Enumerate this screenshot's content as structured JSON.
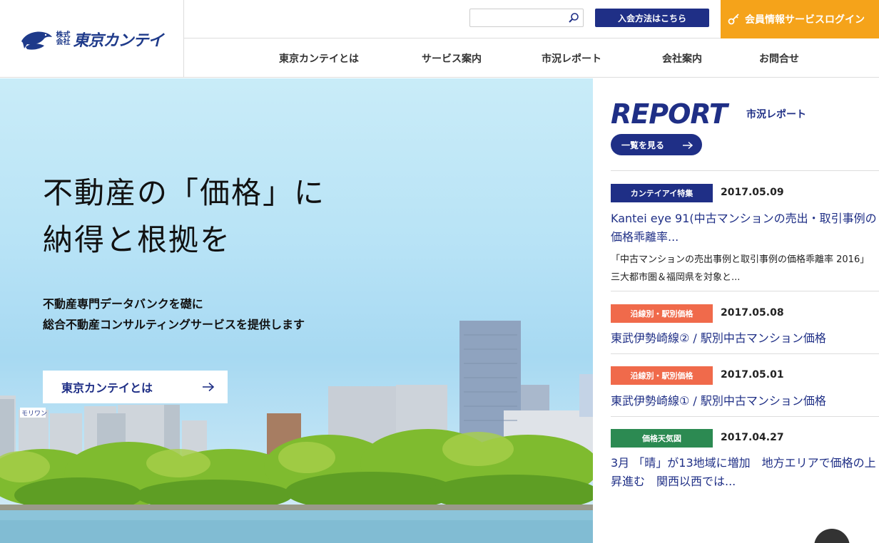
{
  "header": {
    "logo": {
      "kabu_top": "株式",
      "kabu_bottom": "会社",
      "name": "東京カンテイ"
    },
    "search": {
      "placeholder": ""
    },
    "join_label": "入会方法はこちら",
    "login_label": "会員情報サービスログイン",
    "nav": [
      "東京カンテイとは",
      "サービス案内",
      "市況レポート",
      "会社案内",
      "お問合せ"
    ]
  },
  "hero": {
    "title_line1": "不動産の「価格」に",
    "title_line2": "納得と根拠を",
    "sub_line1": "不動産専門データバンクを礎に",
    "sub_line2": "総合不動産コンサルティングサービスを提供します",
    "button_label": "東京カンテイとは",
    "sign_text": "モリワン"
  },
  "report": {
    "title": "REPORT",
    "subtitle": "市況レポート",
    "all_label": "一覧を見る",
    "items": [
      {
        "category": "カンテイアイ特集",
        "color": "#1f2f86",
        "date": "2017.05.09",
        "title": "Kantei eye 91(中古マンションの売出・取引事例の価格乖離率...",
        "desc": "「中古マンションの売出事例と取引事例の価格乖離率 2016」 三大都市圏＆福岡県を対象と..."
      },
      {
        "category": "沿線別・駅別価格",
        "color": "#f06a4b",
        "date": "2017.05.08",
        "title": "東武伊勢崎線② / 駅別中古マンション価格",
        "desc": ""
      },
      {
        "category": "沿線別・駅別価格",
        "color": "#f06a4b",
        "date": "2017.05.01",
        "title": "東武伊勢崎線① / 駅別中古マンション価格",
        "desc": ""
      },
      {
        "category": "価格天気図",
        "color": "#2c8a52",
        "date": "2017.04.27",
        "title": "3月 「晴」が13地域に増加　地方エリアで価格の上昇進む　関西以西では...",
        "desc": ""
      }
    ]
  }
}
